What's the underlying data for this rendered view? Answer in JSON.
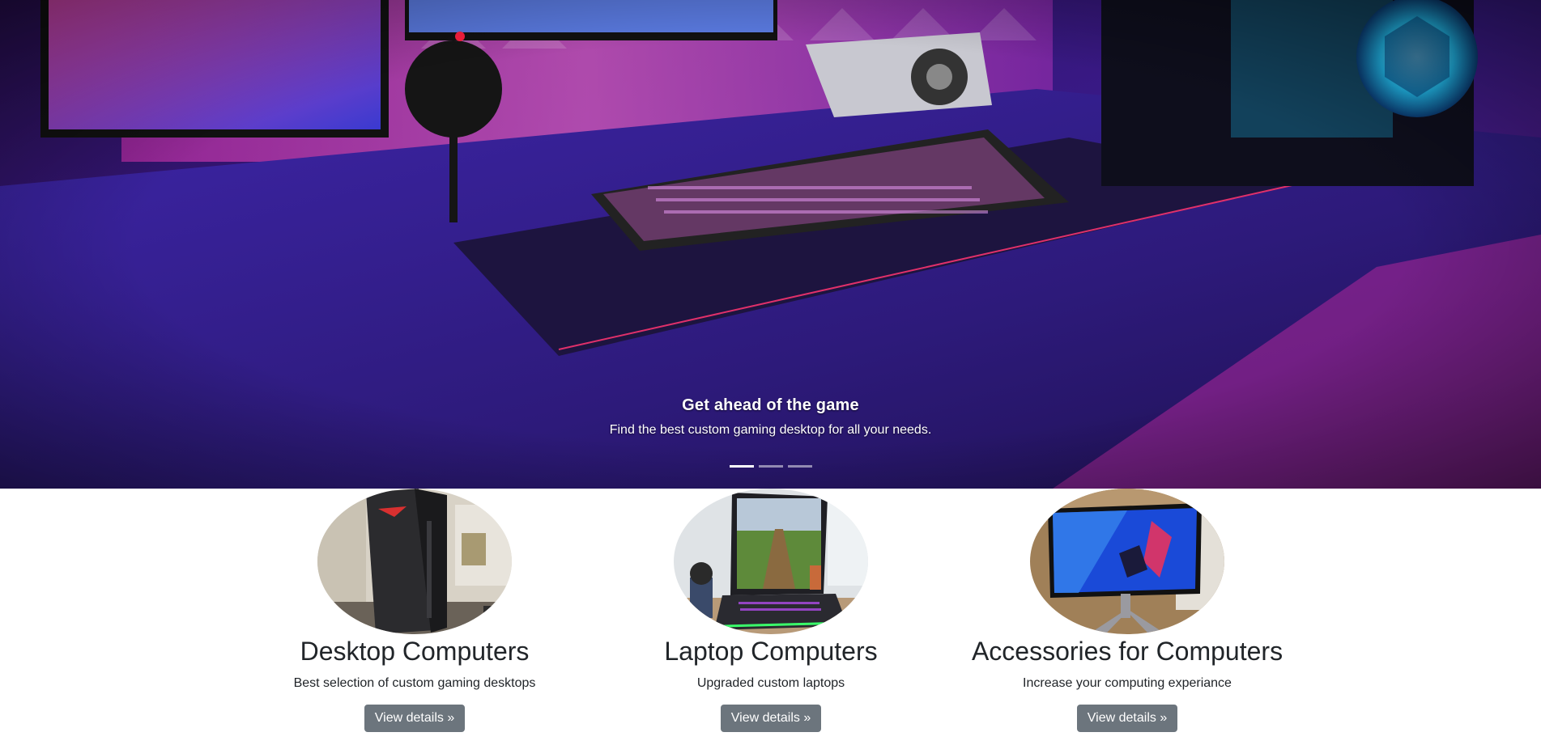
{
  "carousel": {
    "caption_title": "Get ahead of the game",
    "caption_text": "Find the best custom gaming desktop for all your needs.",
    "slide_count": 3,
    "active_index": 0
  },
  "features": [
    {
      "title": "Desktop Computers",
      "text": "Best selection of custom gaming desktops",
      "button_label": "View details »"
    },
    {
      "title": "Laptop Computers",
      "text": "Upgraded custom laptops",
      "button_label": "View details »"
    },
    {
      "title": "Accessories for Computers",
      "text": "Increase your computing experiance",
      "button_label": "View details »"
    }
  ],
  "colors": {
    "button_bg": "#6c757d",
    "text": "#212529",
    "hero_tint": "#5a2bd8"
  }
}
